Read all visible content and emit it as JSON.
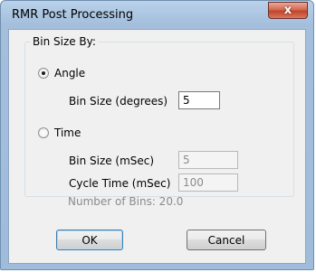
{
  "window": {
    "title": "RMR Post Processing",
    "close_glyph": "x"
  },
  "group": {
    "label": "Bin Size By:"
  },
  "angle": {
    "label": "Angle",
    "checked": true,
    "bin_size_label": "Bin Size (degrees)",
    "bin_size_value": "5"
  },
  "time": {
    "label": "Time",
    "checked": false,
    "bin_size_label": "Bin Size (mSec)",
    "bin_size_value": "5",
    "cycle_time_label": "Cycle Time (mSec)",
    "cycle_time_value": "100",
    "number_of_bins": "Number of Bins: 20.0"
  },
  "buttons": {
    "ok": "OK",
    "cancel": "Cancel"
  }
}
